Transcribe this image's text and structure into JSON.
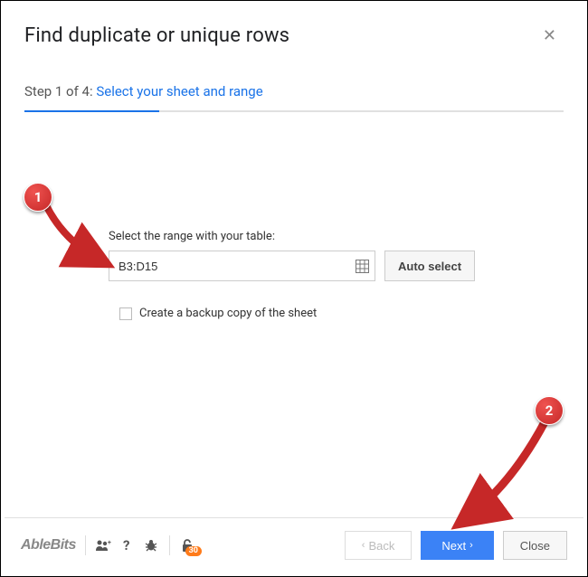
{
  "header": {
    "title": "Find duplicate or unique rows"
  },
  "step": {
    "prefix": "Step 1 of 4: ",
    "link": "Select your sheet and range"
  },
  "form": {
    "range_label": "Select the range with your table:",
    "range_value": "B3:D15",
    "auto_select_label": "Auto select",
    "backup_label": "Create a backup copy of the sheet"
  },
  "footer": {
    "brand": "AbleBits",
    "badge_count": "30",
    "back_label": "Back",
    "next_label": "Next",
    "close_label": "Close"
  },
  "annotations": {
    "one": "1",
    "two": "2"
  }
}
